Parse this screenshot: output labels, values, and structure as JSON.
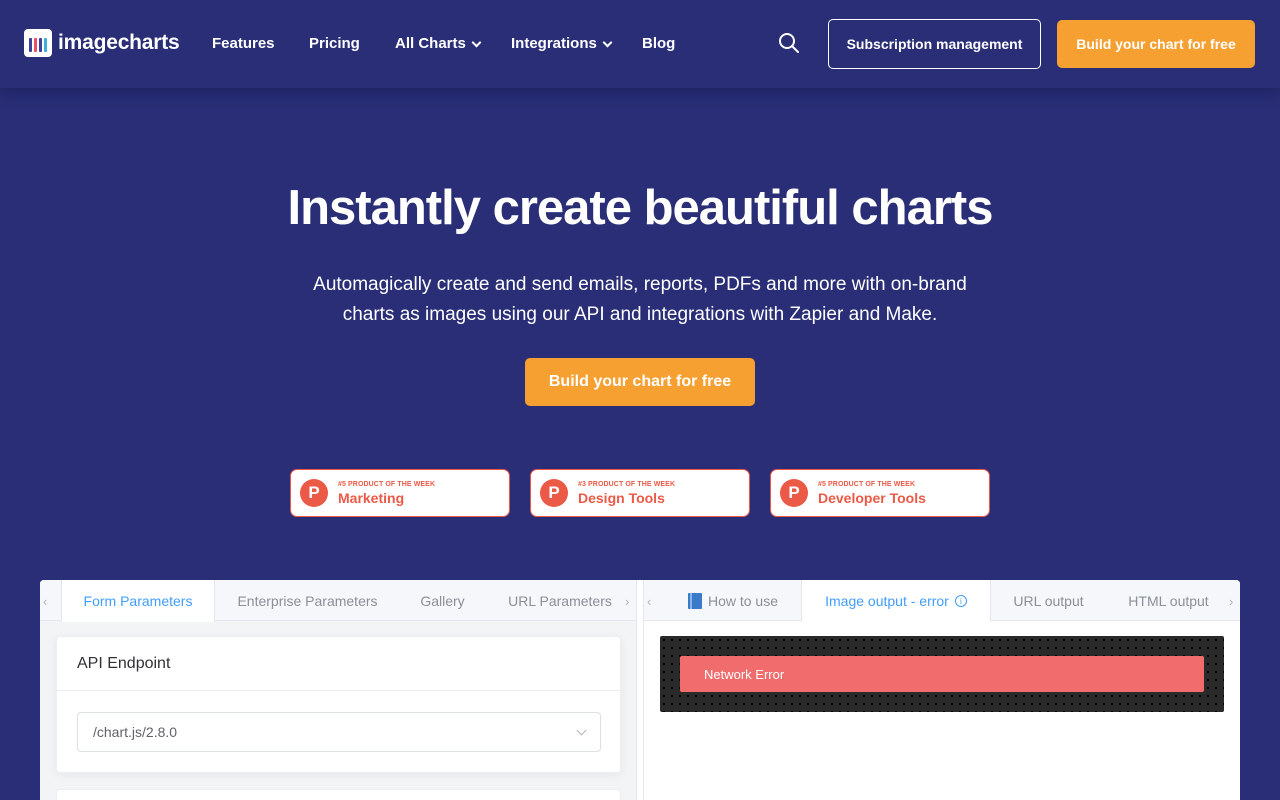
{
  "nav": {
    "logo_text": "imagecharts",
    "links": [
      "Features",
      "Pricing",
      "All Charts",
      "Integrations",
      "Blog"
    ],
    "subscription_button": "Subscription management",
    "cta_button": "Build your chart for free"
  },
  "hero": {
    "title": "Instantly create beautiful charts",
    "subtitle": "Automagically create and send emails, reports, PDFs and more with on-brand charts as images using our API and integrations with Zapier and Make.",
    "cta_button": "Build your chart for free"
  },
  "badges": [
    {
      "rank": "#5 PRODUCT OF THE WEEK",
      "category": "Marketing",
      "logo_letter": "P"
    },
    {
      "rank": "#3 PRODUCT OF THE WEEK",
      "category": "Design Tools",
      "logo_letter": "P"
    },
    {
      "rank": "#5 PRODUCT OF THE WEEK",
      "category": "Developer Tools",
      "logo_letter": "P"
    }
  ],
  "left_panel": {
    "tabs": [
      "Form Parameters",
      "Enterprise Parameters",
      "Gallery",
      "URL Parameters"
    ],
    "active_tab": "Form Parameters",
    "card_title": "API Endpoint",
    "endpoint_value": "/chart.js/2.8.0"
  },
  "right_panel": {
    "tabs": [
      "How to use",
      "Image output - error",
      "URL output",
      "HTML output"
    ],
    "active_tab": "Image output - error",
    "error_message": "Network Error"
  },
  "colors": {
    "background": "#292e76",
    "accent_orange": "#f6a032",
    "badge_red": "#ea5a47",
    "tab_active_blue": "#409eff",
    "error_red": "#f16c6c"
  }
}
